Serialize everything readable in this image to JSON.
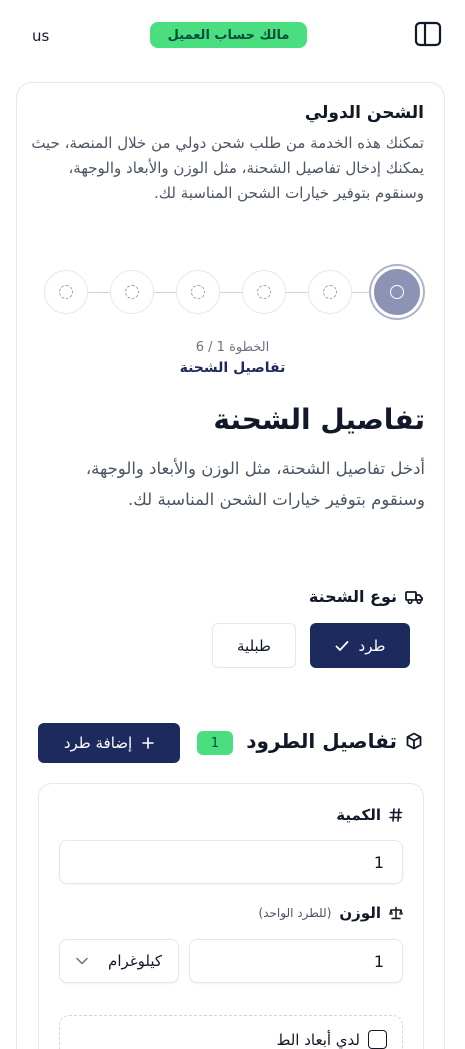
{
  "header": {
    "lang": "us",
    "owner_badge": "مالك حساب العميل"
  },
  "intro": {
    "title": "الشحن الدولي",
    "description": "تمكنك هذه الخدمة من طلب شحن دولي من خلال المنصة، حيث يمكنك إدخال تفاصيل الشحنة، مثل الوزن والأبعاد والوجهة، وسنقوم بتوفير خيارات الشحن المناسبة لك."
  },
  "stepper": {
    "total_steps": 6,
    "current_step": 1,
    "step_count_text": "الخطوة 1 / 6",
    "step_name": "تفاصيل الشحنة"
  },
  "section": {
    "title": "تفاصيل الشحنة",
    "description": "أدخل تفاصيل الشحنة، مثل الوزن والأبعاد والوجهة، وسنقوم بتوفير خيارات الشحن المناسبة لك."
  },
  "shipment_type": {
    "label": "نوع الشحنة",
    "options": [
      "طرد",
      "طبلية"
    ],
    "selected": "طرد"
  },
  "packages": {
    "label": "تفاصيل الطرود",
    "count": "1",
    "add_button": "إضافة طرد",
    "quantity_label": "الكمية",
    "quantity_value": "1",
    "weight_label": "الوزن",
    "weight_hint": "(للطرد الواحد)",
    "weight_value": "1",
    "unit_value": "كيلوغرام",
    "dimensions_checkbox_label": "لدي أبعاد الط"
  },
  "colors": {
    "primary": "#1c2a5e",
    "success": "#4ade80",
    "step_active": "#8c93b5"
  }
}
